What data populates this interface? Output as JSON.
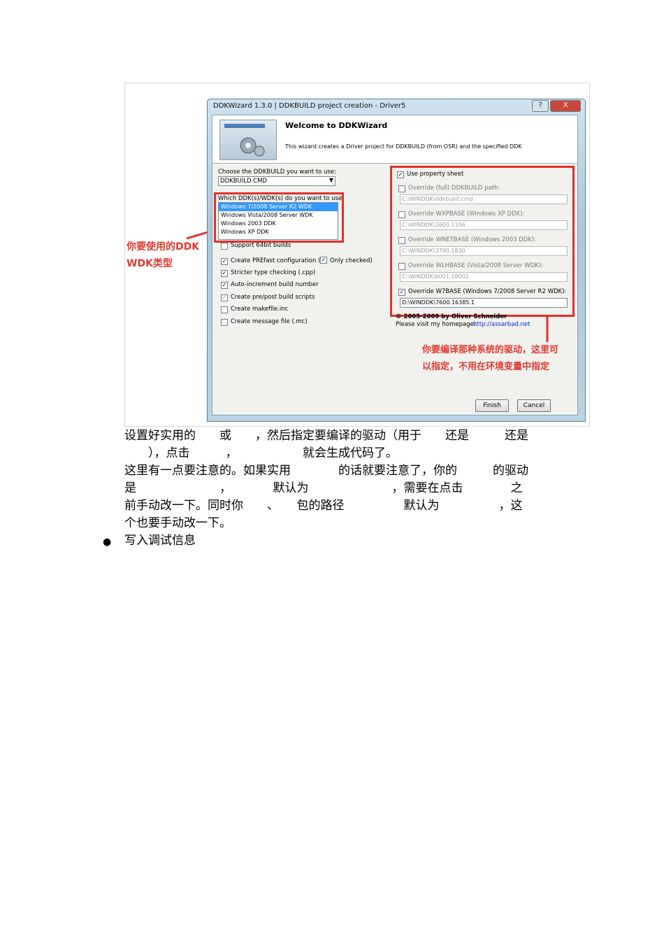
{
  "figure": {
    "annot_left_1": "你要使用的DDK",
    "annot_left_2": "WDK类型",
    "annot_bottom_1": "你要编译那种系统的驱动，这里可",
    "annot_bottom_2": "以指定，不用在环境变量中指定",
    "window": {
      "title": "DDKWizard 1.3.0 | DDKBUILD project creation - Driver5",
      "help_btn": "?",
      "close_btn": "X",
      "banner_title": "Welcome to DDKWizard",
      "banner_sub": "This wizard creates a Driver project for DDKBUILD (from OSR) and the specified DDK",
      "choose_label": "Choose the DDKBUILD you want to use:",
      "choose_value": "DDKBUILD.CMD",
      "which_label": "Which DDK(s)/WDK(s) do you want to use:",
      "ddk_list": [
        "Windows 7/2008 Server R2 WDK",
        "Windows Vista/2008 Server WDK",
        "Windows 2003 DDK",
        "Windows XP DDK"
      ],
      "options": [
        {
          "label": "Support 64bit builds",
          "checked": false
        },
        {
          "label": "Create PREfast configuration (",
          "checked": true
        },
        {
          "label": "Stricter type checking (.cpp)",
          "checked": true
        },
        {
          "label": "Auto-increment build number",
          "checked": true
        },
        {
          "label": "Create pre/post build scripts",
          "checked": true
        },
        {
          "label": "Create makefile.inc",
          "checked": false
        },
        {
          "label": "Create message file (.mc)",
          "checked": false
        }
      ],
      "only_checked": "Only checked)",
      "use_property_sheet": "Use property sheet",
      "overrides": [
        {
          "label": "Override (full) DDKBUILD path:",
          "value": "C:\\WINDDK\\ddkbuild.cmd",
          "checked": false
        },
        {
          "label": "Override WXPBASE (Windows XP DDK):",
          "value": "C:\\WINDDK\\2600.1106",
          "checked": false
        },
        {
          "label": "Override WNETBASE (Windows 2003 DDK):",
          "value": "C:\\WINDDK\\3790.1830",
          "checked": false
        },
        {
          "label": "Override WLHBASE (Vista/2008 Server WDK):",
          "value": "C:\\WINDDK\\6001.18002",
          "checked": false
        },
        {
          "label": "Override W7BASE (Windows 7/2008 Server R2 WDK):",
          "value": "D:\\WINDDK\\7600.16385.1",
          "checked": true
        }
      ],
      "copyright": "© 2005-2009 by Oliver Schneider",
      "homepage_label": "Please visit my homepage:",
      "homepage_url": "http://assarbad.net",
      "finish_btn": "Finish",
      "cancel_btn": "Cancel"
    }
  },
  "text": {
    "line1": "设置好实用的　　或　　，然后指定要编译的驱动（用于　　还是　　　还是",
    "line2": "　　），点击　　　，　　　　　　就会生成代码了。",
    "line3": "这里有一点要注意的。如果实用　　　　的话就要注意了，你的　　　的驱动",
    "line4": "是　　　　　　　，　　　　默认为　　　　　　　，需要在点击　　　　之",
    "line5": "前手动改一下。同时你　　、　　包的路径　　　　　默认为　　　　　，这",
    "line6": "个也要手动改一下。",
    "bullet": "写入调试信息"
  }
}
